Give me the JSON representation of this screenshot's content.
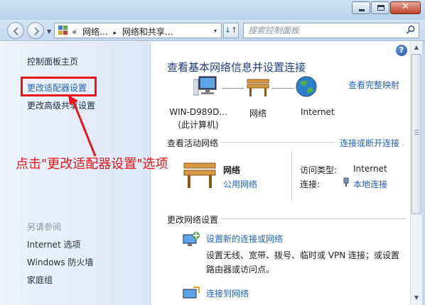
{
  "window": {
    "minimize_glyph": "−",
    "maximize_glyph": "□",
    "close_glyph": "✕"
  },
  "address_bar": {
    "breadcrumbs": [
      "«",
      "网络...",
      "▸",
      "网络和共享...",
      "▾"
    ],
    "search_placeholder": "搜索控制面板"
  },
  "left_pane": {
    "home_link": "控制面板主页",
    "adapter_settings_link": "更改适配器设置",
    "advanced_sharing_link": "更改高级共享设置",
    "see_also_title": "另请参阅",
    "see_also_items": [
      "Internet 选项",
      "Windows 防火墙",
      "家庭组"
    ]
  },
  "main": {
    "heading": "查看基本网络信息并设置连接",
    "full_map_link": "查看完整映射",
    "network_map": {
      "computer_name": "WIN-D989D...",
      "computer_sub": "(此计算机)",
      "network_label": "网络",
      "internet_label": "Internet"
    },
    "active_networks": {
      "title": "查看活动网络",
      "connect_link": "连接或断开连接",
      "network_name": "网络",
      "network_type": "公用网络",
      "access_type_label": "访问类型:",
      "access_type_value": "Internet",
      "connections_label": "连接:",
      "connections_value": "本地连接"
    },
    "change_settings": {
      "title": "更改网络设置",
      "items": [
        {
          "title": "设置新的连接或网络",
          "desc": "设置无线、宽带、拨号、临时或 VPN 连接；或设置路由器或访问点。"
        },
        {
          "title": "连接到网络",
          "desc": ""
        }
      ]
    }
  },
  "annotation": {
    "text": "点击\"更改适配器设置\"选项",
    "color": "#e8141a"
  },
  "colors": {
    "link": "#1f63b8",
    "heading": "#1f3f80"
  }
}
